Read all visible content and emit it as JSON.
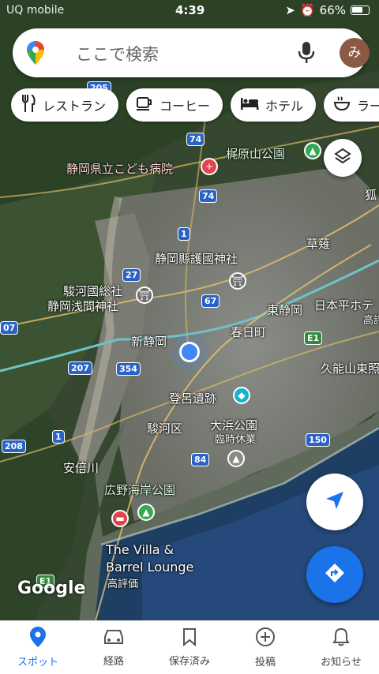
{
  "status": {
    "carrier": "UQ mobile",
    "time": "4:39",
    "battery": "66%",
    "battery_fraction": 0.66
  },
  "search": {
    "placeholder": "ここで検索",
    "avatar_letter": "み"
  },
  "chips": [
    {
      "label": "レストラン",
      "icon": "fork-knife-icon"
    },
    {
      "label": "コーヒー",
      "icon": "coffee-cup-icon"
    },
    {
      "label": "ホテル",
      "icon": "bed-icon"
    },
    {
      "label": "ラー",
      "icon": "ramen-icon"
    }
  ],
  "map": {
    "labels": {
      "bairiyama_park": "梶原山公園",
      "children_hospital": "静岡県立こども病院",
      "gokoku_shrine": "静岡縣護國神社",
      "sengen_shrine_1": "駿河國総社",
      "sengen_shrine_2": "静岡浅間神社",
      "kusanagi": "草薙",
      "higashi_shizuoka": "東静岡",
      "nihondaira_1": "日本平ホテ",
      "nihondaira_2": "高評",
      "shin_shizuoka": "新静岡",
      "kasugacho": "春日町",
      "toro_ruins": "登呂遺跡",
      "kunozan": "久能山東照",
      "suruga_ku": "駿河区",
      "ohama_park": "大浜公園",
      "ohama_closed": "臨時休業",
      "abekawa": "安倍川",
      "hirono_beach_park": "広野海岸公園",
      "villa_1": "The Villa &",
      "villa_2": "Barrel Lounge",
      "villa_rating": "高評価",
      "fox": "狐"
    },
    "shields": [
      "205",
      "74",
      "74",
      "1",
      "27",
      "67",
      "207",
      "354",
      "1",
      "208",
      "84",
      "150",
      "E1",
      "E1",
      "07"
    ],
    "attribution": "Google"
  },
  "nav": [
    {
      "label": "スポット",
      "icon": "pin-icon",
      "active": true
    },
    {
      "label": "経路",
      "icon": "car-icon",
      "active": false
    },
    {
      "label": "保存済み",
      "icon": "bookmark-icon",
      "active": false
    },
    {
      "label": "投稿",
      "icon": "plus-circle-icon",
      "active": false
    },
    {
      "label": "お知らせ",
      "icon": "bell-icon",
      "active": false
    }
  ],
  "colors": {
    "accent": "#1a73e8",
    "user_dot": "#4285f4",
    "poi_red": "#e0454f",
    "poi_green": "#36a852",
    "poi_teal": "#12b5cb"
  }
}
